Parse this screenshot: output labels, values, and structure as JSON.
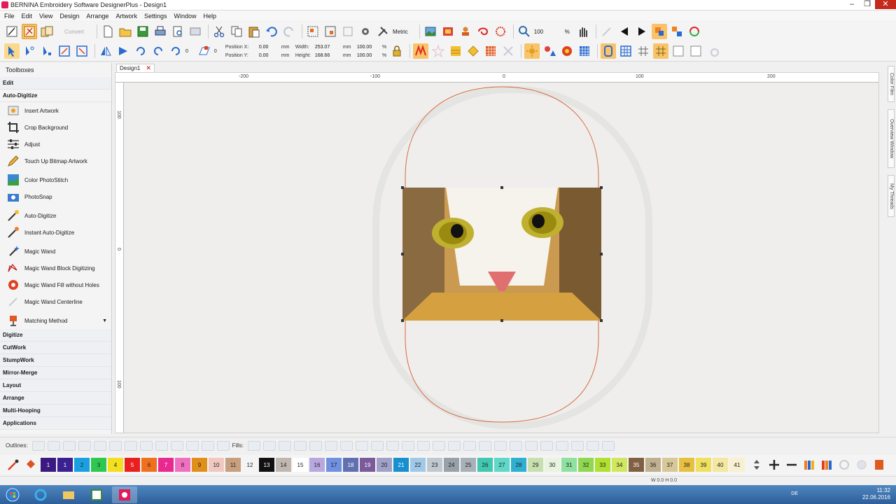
{
  "window": {
    "title": "BERNINA Embroidery Software DesignerPlus - Design1",
    "min": "–",
    "max": "❐",
    "close": "✕"
  },
  "menu": [
    "File",
    "Edit",
    "View",
    "Design",
    "Arrange",
    "Artwork",
    "Settings",
    "Window",
    "Help"
  ],
  "toolbar1": {
    "convert_label": "Convert",
    "units_label": "Metric",
    "zoom_value": "100",
    "zoom_unit": "%"
  },
  "toolbar2": {
    "rotate_value": "0",
    "position_x_label": "Position X:",
    "position_x_value": "0.00",
    "position_y_label": "Position Y:",
    "position_y_value": "0.00",
    "pos_unit": "mm",
    "width_label": "Width:",
    "width_value": "253.07",
    "width_unit": "mm",
    "width_pct": "100.00",
    "height_label": "Height:",
    "height_value": "168.66",
    "height_unit": "mm",
    "height_pct": "100.00",
    "pct_unit": "%"
  },
  "document_tab": {
    "label": "Design1",
    "close": "✕"
  },
  "toolbox": {
    "title": "Toolboxes",
    "categories_top": [
      "Edit",
      "Auto-Digitize"
    ],
    "items": [
      {
        "label": "Insert Artwork",
        "icon": "insert-artwork-icon"
      },
      {
        "label": "Crop Background",
        "icon": "crop-icon"
      },
      {
        "label": "Adjust",
        "icon": "adjust-sliders-icon"
      },
      {
        "label": "Touch Up Bitmap Artwork",
        "icon": "pencil-icon"
      },
      {
        "label": "Color PhotoStitch",
        "icon": "photo-color-icon"
      },
      {
        "label": "PhotoSnap",
        "icon": "camera-icon"
      },
      {
        "label": "Auto-Digitize",
        "icon": "magic-brush-icon"
      },
      {
        "label": "Instant Auto-Digitize",
        "icon": "magic-brush-instant-icon"
      },
      {
        "label": "Magic Wand",
        "icon": "magic-wand-icon"
      },
      {
        "label": "Magic Wand Block Digitizing",
        "icon": "wand-block-icon"
      },
      {
        "label": "Magic Wand Fill without Holes",
        "icon": "wand-fill-icon"
      },
      {
        "label": "Magic Wand Centerline",
        "icon": "wand-centerline-icon"
      },
      {
        "label": "Matching Method",
        "icon": "matching-method-icon"
      }
    ],
    "categories_bottom": [
      "Digitize",
      "CutWork",
      "StumpWork",
      "Mirror-Merge",
      "Layout",
      "Arrange",
      "Multi-Hooping",
      "Applications"
    ]
  },
  "rulers": {
    "h": [
      "-200",
      "-100",
      "0",
      "100",
      "200"
    ],
    "v": [
      "100",
      "0",
      "100"
    ]
  },
  "side_tabs": [
    "Color Film",
    "Overview Window",
    "My Threads"
  ],
  "fills_bar": {
    "outlines_label": "Outlines:",
    "fills_label": "Fills:"
  },
  "colors": [
    {
      "n": "1",
      "c": "#3a1a80"
    },
    {
      "n": "1",
      "c": "#3a2090"
    },
    {
      "n": "2",
      "c": "#1aa0e0"
    },
    {
      "n": "3",
      "c": "#2ec850"
    },
    {
      "n": "4",
      "c": "#f2e020"
    },
    {
      "n": "5",
      "c": "#e82020"
    },
    {
      "n": "6",
      "c": "#f07020"
    },
    {
      "n": "7",
      "c": "#e82a90"
    },
    {
      "n": "8",
      "c": "#f070c0"
    },
    {
      "n": "9",
      "c": "#e0901a"
    },
    {
      "n": "10",
      "c": "#f0c8c0"
    },
    {
      "n": "11",
      "c": "#c8a080"
    },
    {
      "n": "12",
      "c": "#f4f4f4"
    },
    {
      "n": "13",
      "c": "#111111"
    },
    {
      "n": "14",
      "c": "#c0b8b0"
    },
    {
      "n": "15",
      "c": "#ffffff"
    },
    {
      "n": "16",
      "c": "#b8a8e0"
    },
    {
      "n": "17",
      "c": "#7090e0"
    },
    {
      "n": "18",
      "c": "#6070b0"
    },
    {
      "n": "19",
      "c": "#7a5a9a"
    },
    {
      "n": "20",
      "c": "#a0a0c8"
    },
    {
      "n": "21",
      "c": "#1890d0"
    },
    {
      "n": "22",
      "c": "#a0c8e8"
    },
    {
      "n": "23",
      "c": "#c0c8d0"
    },
    {
      "n": "24",
      "c": "#98a0a8"
    },
    {
      "n": "25",
      "c": "#a8b0b8"
    },
    {
      "n": "26",
      "c": "#40c8b0"
    },
    {
      "n": "27",
      "c": "#60d8c8"
    },
    {
      "n": "28",
      "c": "#30b0d0"
    },
    {
      "n": "29",
      "c": "#c8e0b0"
    },
    {
      "n": "30",
      "c": "#e8f4e0"
    },
    {
      "n": "31",
      "c": "#90e0a0"
    },
    {
      "n": "32",
      "c": "#90d850"
    },
    {
      "n": "33",
      "c": "#b0e030"
    },
    {
      "n": "34",
      "c": "#d0e860"
    },
    {
      "n": "35",
      "c": "#806040"
    },
    {
      "n": "36",
      "c": "#c0b090"
    },
    {
      "n": "37",
      "c": "#d8c898"
    },
    {
      "n": "38",
      "c": "#e8c040"
    },
    {
      "n": "39",
      "c": "#f0e060"
    },
    {
      "n": "40",
      "c": "#f4e8a0"
    },
    {
      "n": "41",
      "c": "#f8f0d0"
    }
  ],
  "status": {
    "text": "W  0.0 H  0.0"
  },
  "taskbar": {
    "lang": "DE",
    "time": "11:32",
    "date": "22.06.2016"
  }
}
